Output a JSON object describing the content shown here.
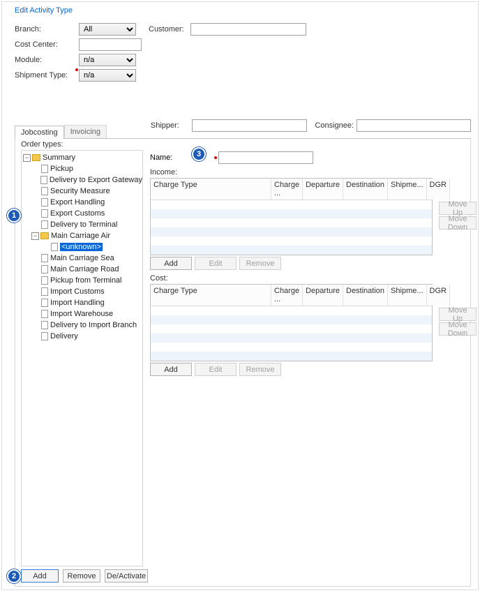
{
  "title": "Edit Activity Type",
  "form": {
    "branch_label": "Branch:",
    "branch_value": "All",
    "costcenter_label": "Cost Center:",
    "costcenter_value": "",
    "module_label": "Module:",
    "module_value": "n/a",
    "shipmenttype_label": "Shipment Type:",
    "shipmenttype_value": "n/a",
    "customer_label": "Customer:",
    "customer_value": "",
    "shipper_label": "Shipper:",
    "shipper_value": "",
    "consignee_label": "Consignee:",
    "consignee_value": ""
  },
  "tabs": {
    "jobcosting": "Jobcosting",
    "invoicing": "Invoicing"
  },
  "order_types_label": "Order types:",
  "tree": {
    "root": "Summary",
    "child_expanded": "Main Carriage Air",
    "child_selected": "<unknown>",
    "items": [
      "Pickup",
      "Delivery to Export Gateway",
      "Security Measure",
      "Export Handling",
      "Export Customs",
      "Delivery to Terminal",
      "Main Carriage Air",
      "Main Carriage Sea",
      "Main Carriage Road",
      "Pickup from Terminal",
      "Import Customs",
      "Import Handling",
      "Import Warehouse",
      "Delivery to Import Branch",
      "Delivery"
    ]
  },
  "right": {
    "name_label": "Name:",
    "name_value": "",
    "income_label": "Income:",
    "cost_label": "Cost:",
    "add": "Add",
    "edit": "Edit",
    "remove": "Remove",
    "moveup": "Move Up",
    "movedown": "Move Down"
  },
  "grid_headers": {
    "charge_type": "Charge Type",
    "charge_n": "Charge ...",
    "departure": "Departure",
    "destination": "Destination",
    "shipment": "Shipme...",
    "dgr": "DGR"
  },
  "bottom": {
    "add": "Add",
    "remove": "Remove",
    "deactivate": "De/Activate"
  },
  "badges": {
    "b1": "1",
    "b2": "2",
    "b3": "3"
  }
}
